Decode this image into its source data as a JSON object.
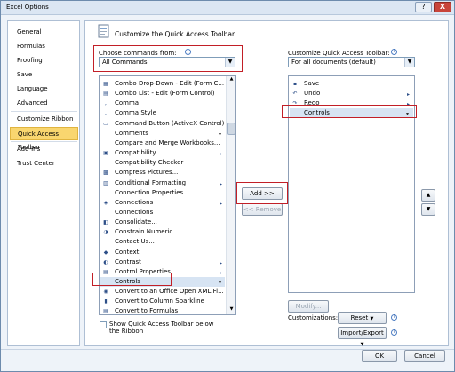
{
  "window": {
    "title": "Excel Options",
    "help_glyph": "?",
    "close_glyph": "X"
  },
  "nav": {
    "items": [
      "General",
      "Formulas",
      "Proofing",
      "Save",
      "Language",
      "Advanced",
      "Customize Ribbon",
      "Quick Access Toolbar",
      "Add-Ins",
      "Trust Center"
    ],
    "selected": "Quick Access Toolbar"
  },
  "heading": "Customize the Quick Access Toolbar.",
  "left": {
    "choose_label": "Choose commands from:",
    "choose_value": "All Commands",
    "commands": [
      {
        "label": "Combo Drop-Down - Edit (Form C...",
        "icon": "combo-dropdown-icon",
        "glyph": "▦"
      },
      {
        "label": "Combo List - Edit (Form Control)",
        "icon": "combo-list-icon",
        "glyph": "▤"
      },
      {
        "label": "Comma",
        "icon": "comma-icon",
        "glyph": ","
      },
      {
        "label": "Comma Style",
        "icon": "comma-style-icon",
        "glyph": ","
      },
      {
        "label": "Command Button (ActiveX Control)",
        "icon": "command-button-icon",
        "glyph": "▭"
      },
      {
        "label": "Comments",
        "icon": "",
        "glyph": ""
      },
      {
        "label": "Compare and Merge Workbooks...",
        "icon": "",
        "glyph": ""
      },
      {
        "label": "Compatibility",
        "icon": "compatibility-icon",
        "glyph": "▣"
      },
      {
        "label": "Compatibility Checker",
        "icon": "",
        "glyph": ""
      },
      {
        "label": "Compress Pictures...",
        "icon": "compress-pictures-icon",
        "glyph": "▩"
      },
      {
        "label": "Conditional Formatting",
        "icon": "conditional-formatting-icon",
        "glyph": "▥"
      },
      {
        "label": "Connection Properties...",
        "icon": "",
        "glyph": ""
      },
      {
        "label": "Connections",
        "icon": "connections-icon",
        "glyph": "◈"
      },
      {
        "label": "Connections",
        "icon": "",
        "glyph": ""
      },
      {
        "label": "Consolidate...",
        "icon": "consolidate-icon",
        "glyph": "◧"
      },
      {
        "label": "Constrain Numeric",
        "icon": "constrain-numeric-icon",
        "glyph": "◑"
      },
      {
        "label": "Contact Us...",
        "icon": "",
        "glyph": ""
      },
      {
        "label": "Context",
        "icon": "context-icon",
        "glyph": "◆"
      },
      {
        "label": "Contrast",
        "icon": "contrast-icon",
        "glyph": "◐"
      },
      {
        "label": "Control Properties",
        "icon": "control-properties-icon",
        "glyph": "▤"
      },
      {
        "label": "Controls",
        "icon": "",
        "glyph": ""
      },
      {
        "label": "Convert to an Office Open XML Fi...",
        "icon": "convert-xml-icon",
        "glyph": "◉"
      },
      {
        "label": "Convert to Column Sparkline",
        "icon": "column-sparkline-icon",
        "glyph": "▮"
      },
      {
        "label": "Convert to Formulas",
        "icon": "convert-formulas-icon",
        "glyph": "▤"
      }
    ],
    "selected_command": "Controls",
    "show_below_ribbon": "Show Quick Access Toolbar below the Ribbon"
  },
  "middle": {
    "add": "Add >>",
    "remove": "<< Remove"
  },
  "right": {
    "customize_label": "Customize Quick Access Toolbar:",
    "customize_value": "For all documents (default)",
    "toolbar_items": [
      {
        "label": "Save",
        "icon": "save-icon",
        "glyph": "▪"
      },
      {
        "label": "Undo",
        "icon": "undo-icon",
        "glyph": "↶"
      },
      {
        "label": "Redo",
        "icon": "redo-icon",
        "glyph": "↷"
      },
      {
        "label": "Controls",
        "icon": "",
        "glyph": ""
      }
    ],
    "selected_item": "Controls",
    "modify": "Modify...",
    "customizations_label": "Customizations:",
    "reset": "Reset",
    "import_export": "Import/Export",
    "info_glyph": "i"
  },
  "footer": {
    "ok": "OK",
    "cancel": "Cancel"
  }
}
